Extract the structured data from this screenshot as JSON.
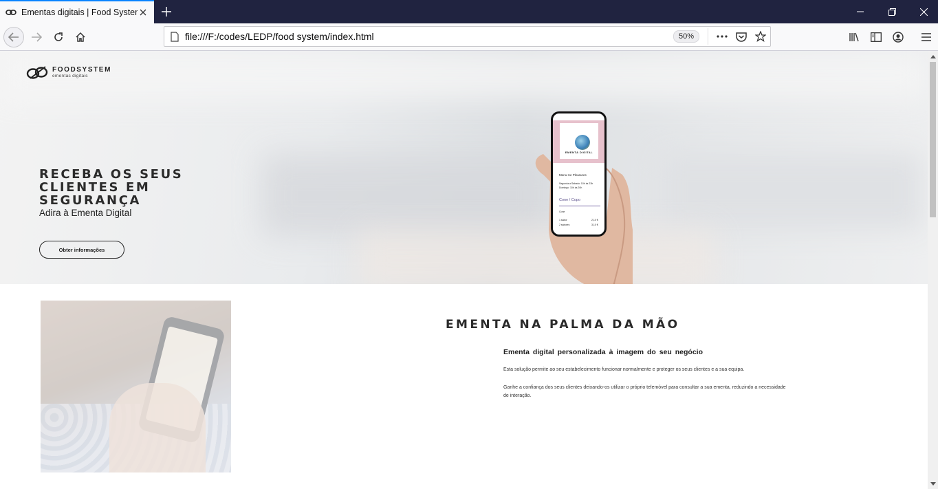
{
  "browser": {
    "tab_title": "Ementas digitais | Food System",
    "url": "file:///F:/codes/LEDP/food system/index.html",
    "zoom": "50%"
  },
  "page": {
    "logo": {
      "name": "FOODSYSTEM",
      "tagline": "ementas digitais"
    },
    "hero": {
      "title": "RECEBA OS SEUS CLIENTES EM SEGURANÇA",
      "subtitle": "Adira à Ementa Digital",
      "button": "Obter informações"
    },
    "phone_screen": {
      "banner_title": "EMENTA DIGITAL",
      "menu_name": "Menu Ice Pleasures",
      "hours_1": "Segunda a Sábado: 10h às 23h",
      "hours_2": "Domingo: 10h às 20h",
      "section": "Cone / Copo",
      "subsection": "Cone",
      "item_1": "1 sabor",
      "price_1": "2,10 €",
      "item_2": "2 sabores",
      "price_2": "3,10 €"
    },
    "section": {
      "title": "EMENTA NA PALMA DA MÃO",
      "subtitle": "Ementa digital personalizada à imagem do seu negócio",
      "paragraph_1": "Esta solução permite ao seu estabelecimento funcionar normalmente e proteger os seus clientes e a sua equipa.",
      "paragraph_2": "Ganhe a confiança dos seus clientes deixando-os utilizar o próprio telemóvel para consultar a sua ementa, reduzindo a necessidade de interação."
    }
  }
}
